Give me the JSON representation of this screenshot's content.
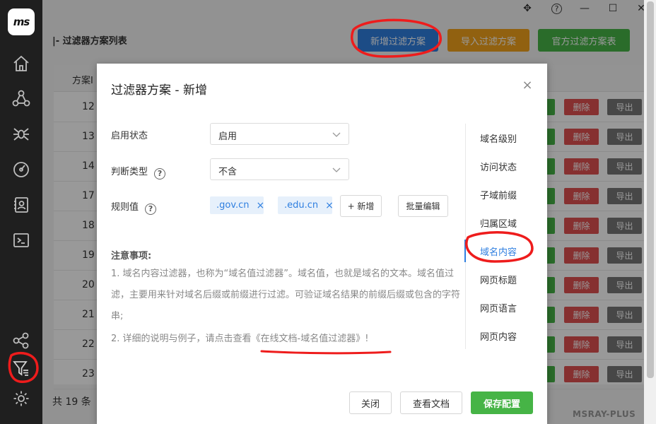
{
  "sidebar": {
    "logo_text": "ms",
    "items": [
      {
        "icon": "home-icon"
      },
      {
        "icon": "topology-icon"
      },
      {
        "icon": "spider-icon"
      },
      {
        "icon": "gauge-icon"
      },
      {
        "icon": "contacts-icon"
      },
      {
        "icon": "terminal-icon"
      },
      {
        "icon": "share-nodes-icon"
      },
      {
        "icon": "filter-icon"
      },
      {
        "icon": "settings-gear-icon"
      }
    ]
  },
  "window": {
    "move": "✥",
    "help": "?",
    "minimize": "—",
    "maximize": "☐",
    "close": "✕"
  },
  "page": {
    "title": "|- 过滤器方案列表",
    "btn_add": "新增过滤方案",
    "btn_import": "导入过滤方案",
    "btn_official": "官方过滤方案表",
    "table_header": "方案I",
    "row_ids": [
      "12",
      "13",
      "14",
      "17",
      "18",
      "19",
      "20",
      "21",
      "22",
      "23"
    ],
    "row_delete": "删除",
    "row_export": "导出",
    "total": "共 19 条",
    "brand": "MSRAY-PLUS"
  },
  "dialog": {
    "title": "过滤器方案 - 新增",
    "close": "×",
    "status_label": "启用状态",
    "status_value": "启用",
    "type_label": "判断类型",
    "type_value": "不含",
    "rule_label": "规则值",
    "tags": [
      ".gov.cn",
      ".edu.cn"
    ],
    "tag_remove": "×",
    "add_button": "+ 新增",
    "bulk_edit_button": "批量编辑",
    "notes_title": "注意事项:",
    "note_1": "1. 域名内容过滤器，也称为“域名值过滤器”。域名值，也就是域名的文本。域名值过滤，主要用来针对域名后缀或前缀进行过滤。可验证域名结果的前缀后缀或包含的字符串;",
    "note_2_prefix": "2. 详细的说明与例子，请点击查看",
    "note_2_link": "《在线文档-域名值过滤器》",
    "note_2_suffix": "!",
    "side_menu": [
      "域名级别",
      "访问状态",
      "子域前缀",
      "归属区域",
      "域名内容",
      "网页标题",
      "网页语言",
      "网页内容"
    ],
    "active_side_index": 4,
    "btn_close": "关闭",
    "btn_docs": "查看文档",
    "btn_save": "保存配置"
  },
  "colors": {
    "accent": "#2f7fe0",
    "success": "#46b446",
    "warning": "#f2a21c",
    "danger": "#e05050",
    "annotation": "#ee1c1c"
  }
}
